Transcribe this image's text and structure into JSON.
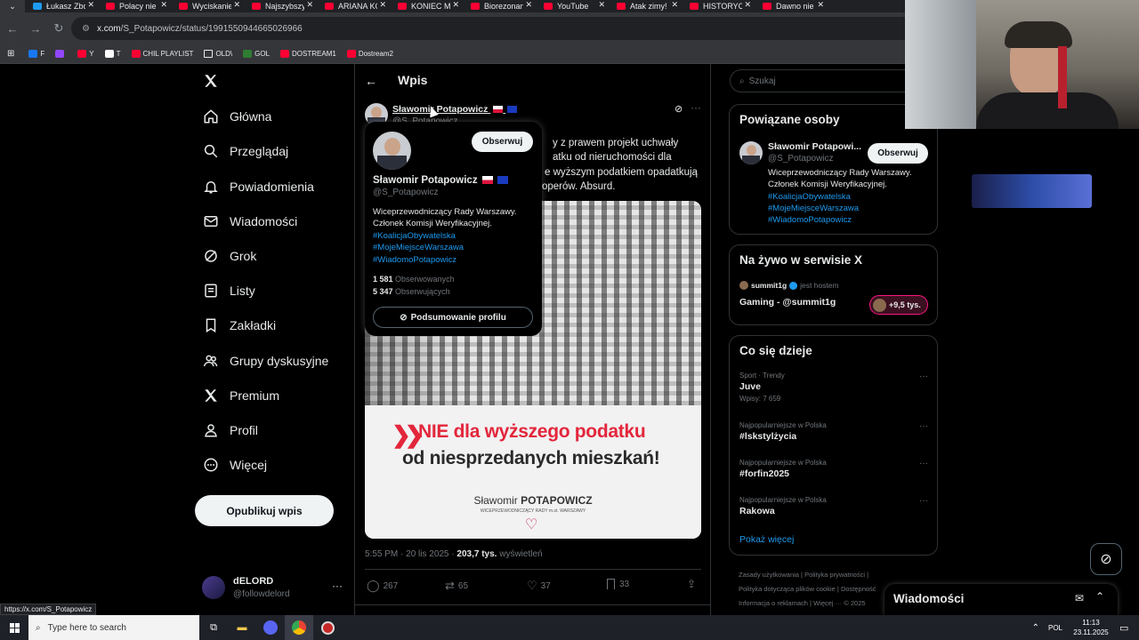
{
  "browser": {
    "tabs": [
      {
        "label": "Łukasz Zbor",
        "color": "#1d9bf0",
        "active": false
      },
      {
        "label": "Polacy nie ch",
        "color": "#ff0033",
        "active": false
      },
      {
        "label": "Wyciskanie s",
        "color": "#ff0033",
        "active": false
      },
      {
        "label": "Najszybszy C",
        "color": "#ff0033",
        "active": false
      },
      {
        "label": "ARIANA KON",
        "color": "#ff0033",
        "active": false
      },
      {
        "label": "KONIEC MA",
        "color": "#ff0033",
        "active": false
      },
      {
        "label": "Biorezonans",
        "color": "#ff0033",
        "active": false
      },
      {
        "label": "YouTube",
        "color": "#ff0033",
        "active": false
      },
      {
        "label": "Atak zimy! T",
        "color": "#ff0033",
        "active": false
      },
      {
        "label": "HISTORYCZN",
        "color": "#ff0033",
        "active": false
      },
      {
        "label": "Dawno nie ",
        "color": "#ff0033",
        "active": false
      }
    ],
    "url_host": "x.com",
    "url_path": "/S_Potapowicz/status/1991550944665026966",
    "bookmarks": [
      {
        "label": "F",
        "color": "#1877f2"
      },
      {
        "label": "",
        "color": "#9146ff"
      },
      {
        "label": "Y",
        "color": "#ff0033"
      },
      {
        "label": "T",
        "color": "#ffffff"
      },
      {
        "label": "CHIL PLAYLIST",
        "color": "#ff0033"
      },
      {
        "label": "OLD\\",
        "color": "folder"
      },
      {
        "label": "GOL",
        "color": "#2e7d32"
      },
      {
        "label": "DOSTREAM1",
        "color": "#ff0033"
      },
      {
        "label": "Dostream2",
        "color": "#ff0033"
      }
    ],
    "status_url": "https://x.com/S_Potapowicz"
  },
  "nav": {
    "logo": "X",
    "items": [
      {
        "label": "Główna",
        "icon": "home-icon"
      },
      {
        "label": "Przeglądaj",
        "icon": "search-icon"
      },
      {
        "label": "Powiadomienia",
        "icon": "bell-icon"
      },
      {
        "label": "Wiadomości",
        "icon": "mail-icon"
      },
      {
        "label": "Grok",
        "icon": "grok-icon"
      },
      {
        "label": "Listy",
        "icon": "list-icon"
      },
      {
        "label": "Zakładki",
        "icon": "bookmark-icon"
      },
      {
        "label": "Grupy dyskusyjne",
        "icon": "people-icon"
      },
      {
        "label": "Premium",
        "icon": "x-icon"
      },
      {
        "label": "Profil",
        "icon": "person-icon"
      },
      {
        "label": "Więcej",
        "icon": "more-circle-icon"
      }
    ],
    "post_button": "Opublikuj wpis",
    "account_name": "dELORD",
    "account_handle": "@followdelord"
  },
  "main": {
    "header_title": "Wpis",
    "author_name": "Sławomir Potapowicz",
    "author_handle": "@S_Potapowicz",
    "text_lines": [
      "y z prawem projekt uchwały",
      "atku od nieruchomości dla",
      "e wyższym podatkiem opadatkują",
      "operów. Absurd."
    ],
    "image_headline_1": "NIE dla wyższego podatku",
    "image_headline_2": "od niesprzedanych mieszkań!",
    "image_signature_first": "Sławomir",
    "image_signature_last": "POTAPOWICZ",
    "image_signature_role": "WICEPRZEWODNICZĄCY RADY m.st. WARSZAWY",
    "meta_time": "5:55 PM · 20 lis 2025 ·",
    "meta_views_count": "203,7 tys.",
    "meta_views_label": "wyświetleń",
    "replies": "267",
    "reposts": "65",
    "likes": "37",
    "bookmarks": "33"
  },
  "hovercard": {
    "follow_button": "Obserwuj",
    "name": "Sławomir Potapowicz",
    "handle": "@S_Potapowicz",
    "bio_line1": "Wiceprzewodniczący Rady Warszawy.",
    "bio_line2": "Członek Komisji Weryfikacyjnej.",
    "hashtags": [
      "#KoalicjaObywatelska",
      "#MojeMiejsceWarszawa",
      "#WiadomoPotapowicz"
    ],
    "following_count": "1 581",
    "following_label": "Obserwowanych",
    "followers_count": "5 347",
    "followers_label": "Obserwujących",
    "summary_button": "Podsumowanie profilu"
  },
  "right": {
    "search_placeholder": "Szukaj",
    "related_title": "Powiązane osoby",
    "related_name": "Sławomir Potapowi...",
    "related_handle": "@S_Potapowicz",
    "related_follow": "Obserwuj",
    "related_bio1": "Wiceprzewodniczący Rady Warszawy.",
    "related_bio2": "Członek Komisji Weryfikacyjnej.",
    "related_tags": [
      "#KoalicjaObywatelska",
      "#MojeMiejsceWarszawa",
      "#WiadomoPotapowicz"
    ],
    "live_title": "Na żywo w serwisie X",
    "live_host": "summit1g",
    "live_host_suffix": "jest hostem",
    "live_event": "Gaming - @summit1g",
    "live_count": "+9,5 tys.",
    "trends_title": "Co się dzieje",
    "trends": [
      {
        "context": "Sport · Trendy",
        "name": "Juve",
        "posts": "Wpisy: 7 659"
      },
      {
        "context": "Najpopularniejsze w Polska",
        "name": "#lskstylżycia",
        "posts": ""
      },
      {
        "context": "Najpopularniejsze w Polska",
        "name": "#forfin2025",
        "posts": ""
      },
      {
        "context": "Najpopularniejsze w Polska",
        "name": "Rakowa",
        "posts": ""
      }
    ],
    "show_more": "Pokaż więcej",
    "footer_1a": "Zasady użytkowania",
    "footer_1b": "Polityka prywatności",
    "footer_2a": "Polityka dotycząca plików cookie",
    "footer_2b": "Dostępność",
    "footer_3a": "Informacja o reklamach",
    "footer_3b": "Więcej ···",
    "footer_3c": "© 2025",
    "messages_label": "Wiadomości"
  },
  "taskbar": {
    "search_placeholder": "Type here to search",
    "language": "POL",
    "time": "11:13",
    "date": "23.11.2025"
  }
}
